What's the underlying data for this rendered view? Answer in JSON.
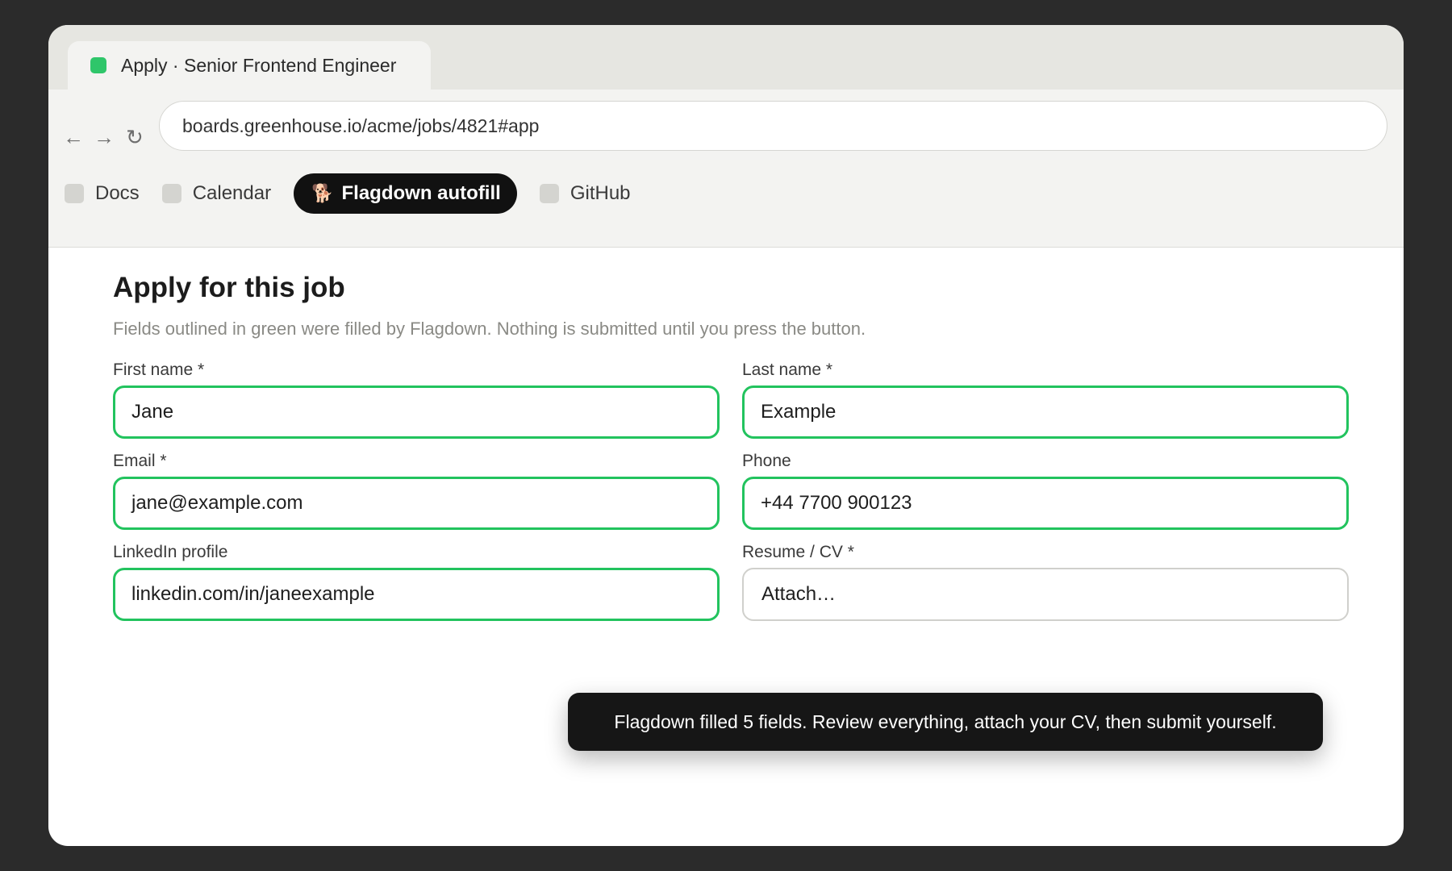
{
  "colors": {
    "accent_green": "#22c35e",
    "tab_dot": "#2fc66a",
    "toast_bg": "#161616"
  },
  "tab": {
    "title": "Apply · Senior Frontend Engineer",
    "icon": "green-square-favicon"
  },
  "toolbar": {
    "back_icon": "←",
    "forward_icon": "→",
    "reload_icon": "↻",
    "url": "boards.greenhouse.io/acme/jobs/4821#app"
  },
  "bookmarks": [
    {
      "label": "Docs"
    },
    {
      "label": "Calendar"
    },
    {
      "label": "Flagdown autofill",
      "emoji": "🐕",
      "active": true
    },
    {
      "label": "GitHub"
    }
  ],
  "page": {
    "title": "Apply for this job",
    "subtitle": "Fields outlined in green were filled by Flagdown. Nothing is submitted until you press the button."
  },
  "form": {
    "fields": [
      {
        "label": "First name *",
        "value": "Jane",
        "filled": true
      },
      {
        "label": "Last name *",
        "value": "Example",
        "filled": true
      },
      {
        "label": "Email *",
        "value": "jane@example.com",
        "filled": true
      },
      {
        "label": "Phone",
        "value": "+44 7700 900123",
        "filled": true
      },
      {
        "label": "LinkedIn profile",
        "value": "linkedin.com/in/janeexample",
        "filled": true
      },
      {
        "label": "Resume / CV *",
        "value": "Attach…",
        "filled": false
      }
    ]
  },
  "toast": {
    "message": "Flagdown filled 5 fields. Review everything, attach your CV, then submit yourself."
  }
}
